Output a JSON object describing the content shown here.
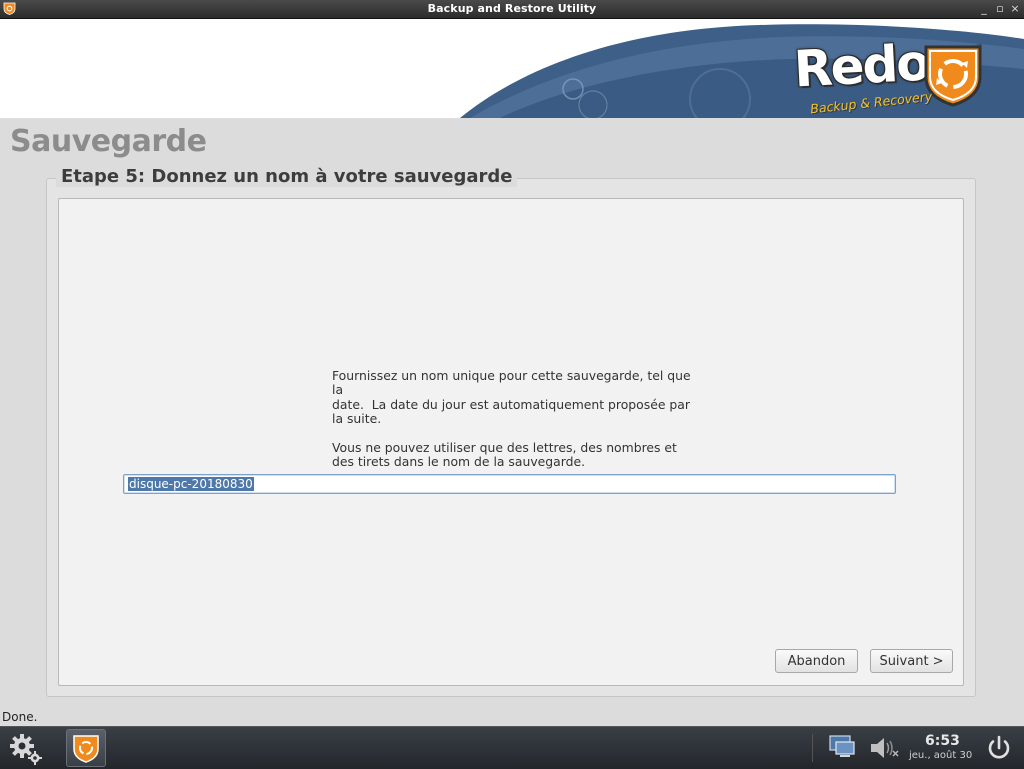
{
  "window": {
    "title": "Backup and Restore Utility"
  },
  "banner": {
    "logo_text": "Redo",
    "logo_tagline": "Backup & Recovery",
    "logo_tm": "™"
  },
  "page": {
    "title": "Sauvegarde",
    "step_title": "Etape 5: Donnez un nom à votre sauvegarde",
    "instructions": "Fournissez un nom unique pour cette sauvegarde, tel que la\ndate.  La date du jour est automatiquement proposée par\nla suite.\n\nVous ne pouvez utiliser que des lettres, des nombres et\ndes tirets dans le nom de la sauvegarde.",
    "backup_name_value": "disque-pc-20180830"
  },
  "buttons": {
    "cancel_label": "Abandon",
    "next_label": "Suivant >"
  },
  "status_bar": {
    "text": "Done."
  },
  "taskbar": {
    "clock_time": "6:53",
    "clock_date": "jeu., août 30"
  },
  "colors": {
    "accent_blue": "#4d78a8",
    "logo_orange": "#f08a1c",
    "banner_wave": "#3e5f88"
  }
}
